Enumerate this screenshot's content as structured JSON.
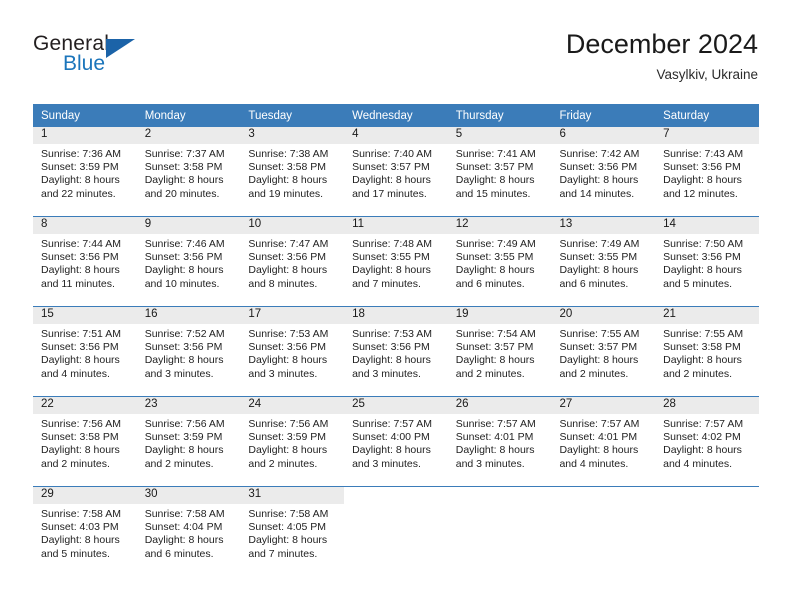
{
  "brand": {
    "name_part1": "General",
    "name_part2": "Blue",
    "accent_color": "#1b75bb",
    "triangle_color": "#1b63a8"
  },
  "header": {
    "title": "December 2024",
    "subtitle": "Vasylkiv, Ukraine"
  },
  "theme": {
    "header_row_bg": "#3b7cb9",
    "daynum_band_bg": "#ebebeb",
    "grid_line": "#3b7cb9",
    "text": "#222222"
  },
  "weekdays": [
    "Sunday",
    "Monday",
    "Tuesday",
    "Wednesday",
    "Thursday",
    "Friday",
    "Saturday"
  ],
  "weeks": [
    [
      {
        "day": "1",
        "sunrise": "Sunrise: 7:36 AM",
        "sunset": "Sunset: 3:59 PM",
        "daylight_line1": "Daylight: 8 hours",
        "daylight_line2": "and 22 minutes."
      },
      {
        "day": "2",
        "sunrise": "Sunrise: 7:37 AM",
        "sunset": "Sunset: 3:58 PM",
        "daylight_line1": "Daylight: 8 hours",
        "daylight_line2": "and 20 minutes."
      },
      {
        "day": "3",
        "sunrise": "Sunrise: 7:38 AM",
        "sunset": "Sunset: 3:58 PM",
        "daylight_line1": "Daylight: 8 hours",
        "daylight_line2": "and 19 minutes."
      },
      {
        "day": "4",
        "sunrise": "Sunrise: 7:40 AM",
        "sunset": "Sunset: 3:57 PM",
        "daylight_line1": "Daylight: 8 hours",
        "daylight_line2": "and 17 minutes."
      },
      {
        "day": "5",
        "sunrise": "Sunrise: 7:41 AM",
        "sunset": "Sunset: 3:57 PM",
        "daylight_line1": "Daylight: 8 hours",
        "daylight_line2": "and 15 minutes."
      },
      {
        "day": "6",
        "sunrise": "Sunrise: 7:42 AM",
        "sunset": "Sunset: 3:56 PM",
        "daylight_line1": "Daylight: 8 hours",
        "daylight_line2": "and 14 minutes."
      },
      {
        "day": "7",
        "sunrise": "Sunrise: 7:43 AM",
        "sunset": "Sunset: 3:56 PM",
        "daylight_line1": "Daylight: 8 hours",
        "daylight_line2": "and 12 minutes."
      }
    ],
    [
      {
        "day": "8",
        "sunrise": "Sunrise: 7:44 AM",
        "sunset": "Sunset: 3:56 PM",
        "daylight_line1": "Daylight: 8 hours",
        "daylight_line2": "and 11 minutes."
      },
      {
        "day": "9",
        "sunrise": "Sunrise: 7:46 AM",
        "sunset": "Sunset: 3:56 PM",
        "daylight_line1": "Daylight: 8 hours",
        "daylight_line2": "and 10 minutes."
      },
      {
        "day": "10",
        "sunrise": "Sunrise: 7:47 AM",
        "sunset": "Sunset: 3:56 PM",
        "daylight_line1": "Daylight: 8 hours",
        "daylight_line2": "and 8 minutes."
      },
      {
        "day": "11",
        "sunrise": "Sunrise: 7:48 AM",
        "sunset": "Sunset: 3:55 PM",
        "daylight_line1": "Daylight: 8 hours",
        "daylight_line2": "and 7 minutes."
      },
      {
        "day": "12",
        "sunrise": "Sunrise: 7:49 AM",
        "sunset": "Sunset: 3:55 PM",
        "daylight_line1": "Daylight: 8 hours",
        "daylight_line2": "and 6 minutes."
      },
      {
        "day": "13",
        "sunrise": "Sunrise: 7:49 AM",
        "sunset": "Sunset: 3:55 PM",
        "daylight_line1": "Daylight: 8 hours",
        "daylight_line2": "and 6 minutes."
      },
      {
        "day": "14",
        "sunrise": "Sunrise: 7:50 AM",
        "sunset": "Sunset: 3:56 PM",
        "daylight_line1": "Daylight: 8 hours",
        "daylight_line2": "and 5 minutes."
      }
    ],
    [
      {
        "day": "15",
        "sunrise": "Sunrise: 7:51 AM",
        "sunset": "Sunset: 3:56 PM",
        "daylight_line1": "Daylight: 8 hours",
        "daylight_line2": "and 4 minutes."
      },
      {
        "day": "16",
        "sunrise": "Sunrise: 7:52 AM",
        "sunset": "Sunset: 3:56 PM",
        "daylight_line1": "Daylight: 8 hours",
        "daylight_line2": "and 3 minutes."
      },
      {
        "day": "17",
        "sunrise": "Sunrise: 7:53 AM",
        "sunset": "Sunset: 3:56 PM",
        "daylight_line1": "Daylight: 8 hours",
        "daylight_line2": "and 3 minutes."
      },
      {
        "day": "18",
        "sunrise": "Sunrise: 7:53 AM",
        "sunset": "Sunset: 3:56 PM",
        "daylight_line1": "Daylight: 8 hours",
        "daylight_line2": "and 3 minutes."
      },
      {
        "day": "19",
        "sunrise": "Sunrise: 7:54 AM",
        "sunset": "Sunset: 3:57 PM",
        "daylight_line1": "Daylight: 8 hours",
        "daylight_line2": "and 2 minutes."
      },
      {
        "day": "20",
        "sunrise": "Sunrise: 7:55 AM",
        "sunset": "Sunset: 3:57 PM",
        "daylight_line1": "Daylight: 8 hours",
        "daylight_line2": "and 2 minutes."
      },
      {
        "day": "21",
        "sunrise": "Sunrise: 7:55 AM",
        "sunset": "Sunset: 3:58 PM",
        "daylight_line1": "Daylight: 8 hours",
        "daylight_line2": "and 2 minutes."
      }
    ],
    [
      {
        "day": "22",
        "sunrise": "Sunrise: 7:56 AM",
        "sunset": "Sunset: 3:58 PM",
        "daylight_line1": "Daylight: 8 hours",
        "daylight_line2": "and 2 minutes."
      },
      {
        "day": "23",
        "sunrise": "Sunrise: 7:56 AM",
        "sunset": "Sunset: 3:59 PM",
        "daylight_line1": "Daylight: 8 hours",
        "daylight_line2": "and 2 minutes."
      },
      {
        "day": "24",
        "sunrise": "Sunrise: 7:56 AM",
        "sunset": "Sunset: 3:59 PM",
        "daylight_line1": "Daylight: 8 hours",
        "daylight_line2": "and 2 minutes."
      },
      {
        "day": "25",
        "sunrise": "Sunrise: 7:57 AM",
        "sunset": "Sunset: 4:00 PM",
        "daylight_line1": "Daylight: 8 hours",
        "daylight_line2": "and 3 minutes."
      },
      {
        "day": "26",
        "sunrise": "Sunrise: 7:57 AM",
        "sunset": "Sunset: 4:01 PM",
        "daylight_line1": "Daylight: 8 hours",
        "daylight_line2": "and 3 minutes."
      },
      {
        "day": "27",
        "sunrise": "Sunrise: 7:57 AM",
        "sunset": "Sunset: 4:01 PM",
        "daylight_line1": "Daylight: 8 hours",
        "daylight_line2": "and 4 minutes."
      },
      {
        "day": "28",
        "sunrise": "Sunrise: 7:57 AM",
        "sunset": "Sunset: 4:02 PM",
        "daylight_line1": "Daylight: 8 hours",
        "daylight_line2": "and 4 minutes."
      }
    ],
    [
      {
        "day": "29",
        "sunrise": "Sunrise: 7:58 AM",
        "sunset": "Sunset: 4:03 PM",
        "daylight_line1": "Daylight: 8 hours",
        "daylight_line2": "and 5 minutes."
      },
      {
        "day": "30",
        "sunrise": "Sunrise: 7:58 AM",
        "sunset": "Sunset: 4:04 PM",
        "daylight_line1": "Daylight: 8 hours",
        "daylight_line2": "and 6 minutes."
      },
      {
        "day": "31",
        "sunrise": "Sunrise: 7:58 AM",
        "sunset": "Sunset: 4:05 PM",
        "daylight_line1": "Daylight: 8 hours",
        "daylight_line2": "and 7 minutes."
      },
      {
        "day": "",
        "sunrise": "",
        "sunset": "",
        "daylight_line1": "",
        "daylight_line2": ""
      },
      {
        "day": "",
        "sunrise": "",
        "sunset": "",
        "daylight_line1": "",
        "daylight_line2": ""
      },
      {
        "day": "",
        "sunrise": "",
        "sunset": "",
        "daylight_line1": "",
        "daylight_line2": ""
      },
      {
        "day": "",
        "sunrise": "",
        "sunset": "",
        "daylight_line1": "",
        "daylight_line2": ""
      }
    ]
  ]
}
